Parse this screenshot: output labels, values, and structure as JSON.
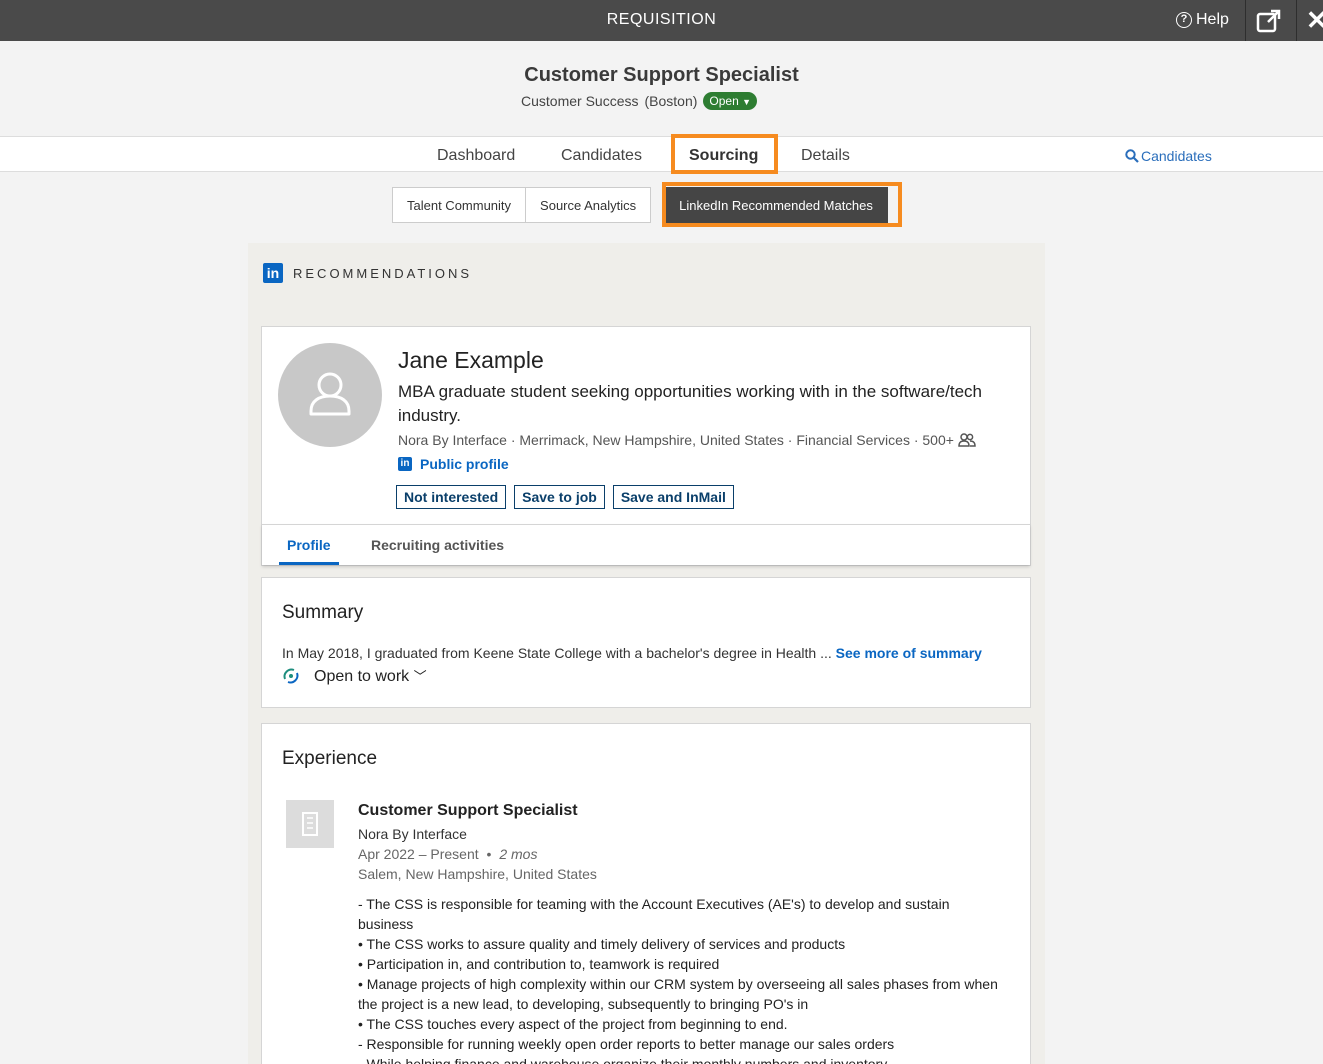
{
  "topbar": {
    "title": "REQUISITION",
    "help_label": "Help"
  },
  "header": {
    "job_title": "Customer Support Specialist",
    "department": "Customer Success",
    "location": "(Boston)",
    "status": "Open"
  },
  "nav": {
    "tabs": [
      {
        "label": "Dashboard"
      },
      {
        "label": "Candidates"
      },
      {
        "label": "Sourcing"
      },
      {
        "label": "Details"
      }
    ],
    "active": "Sourcing",
    "search_label": "Candidates"
  },
  "subtabs": {
    "items": [
      {
        "label": "Talent Community"
      },
      {
        "label": "Source Analytics"
      },
      {
        "label": "LinkedIn Recommended Matches"
      }
    ],
    "active": "LinkedIn Recommended Matches"
  },
  "recommendations": {
    "logo_text": "in",
    "title": "RECOMMENDATIONS"
  },
  "profile": {
    "name": "Jane Example",
    "headline": "MBA graduate student seeking opportunities working with in the software/tech industry.",
    "meta": "Nora By Interface · Merrimack, New Hampshire, United States · Financial Services · 500+",
    "public_profile_label": "Public profile",
    "actions": {
      "not_interested": "Not interested",
      "save_to_job": "Save to job",
      "save_and_inmail": "Save and InMail"
    },
    "tabs": {
      "profile": "Profile",
      "recruiting": "Recruiting activities"
    }
  },
  "summary": {
    "title": "Summary",
    "text": "In May 2018, I graduated from Keene State College with a bachelor's degree in Health ...",
    "see_more": "See more of summary",
    "open_to_work": "Open to work"
  },
  "experience": {
    "title": "Experience",
    "role": "Customer Support Specialist",
    "company": "Nora By Interface",
    "dates": "Apr 2022 – Present",
    "separator": "•",
    "duration": "2 mos",
    "location": "Salem, New Hampshire, United States",
    "description": [
      "- The CSS is responsible for teaming with the Account Executives (AE's) to develop and sustain business",
      "• The CSS works to assure quality and timely delivery of services and products",
      "• Participation in, and contribution to, teamwork is required",
      "• Manage projects of high complexity within our CRM system by overseeing all sales phases from when the project is a new lead, to developing, subsequently to bringing PO's in",
      "• The CSS touches every aspect of the project from beginning to end.",
      "- Responsible for running weekly open order reports to better manage our sales orders",
      "- While helping finance and warehouse organize their monthly numbers and inventory"
    ]
  },
  "colors": {
    "topbar": "#4a4a4a",
    "highlight": "#f68b1f",
    "linkedin_blue": "#0a66c2",
    "status_green": "#2e7d32"
  },
  "icons": [
    "help-icon",
    "external-link-icon",
    "close-icon",
    "search-icon",
    "linkedin-icon",
    "avatar-placeholder-icon",
    "connections-icon",
    "open-to-work-icon",
    "chevron-down-icon",
    "company-building-icon"
  ]
}
